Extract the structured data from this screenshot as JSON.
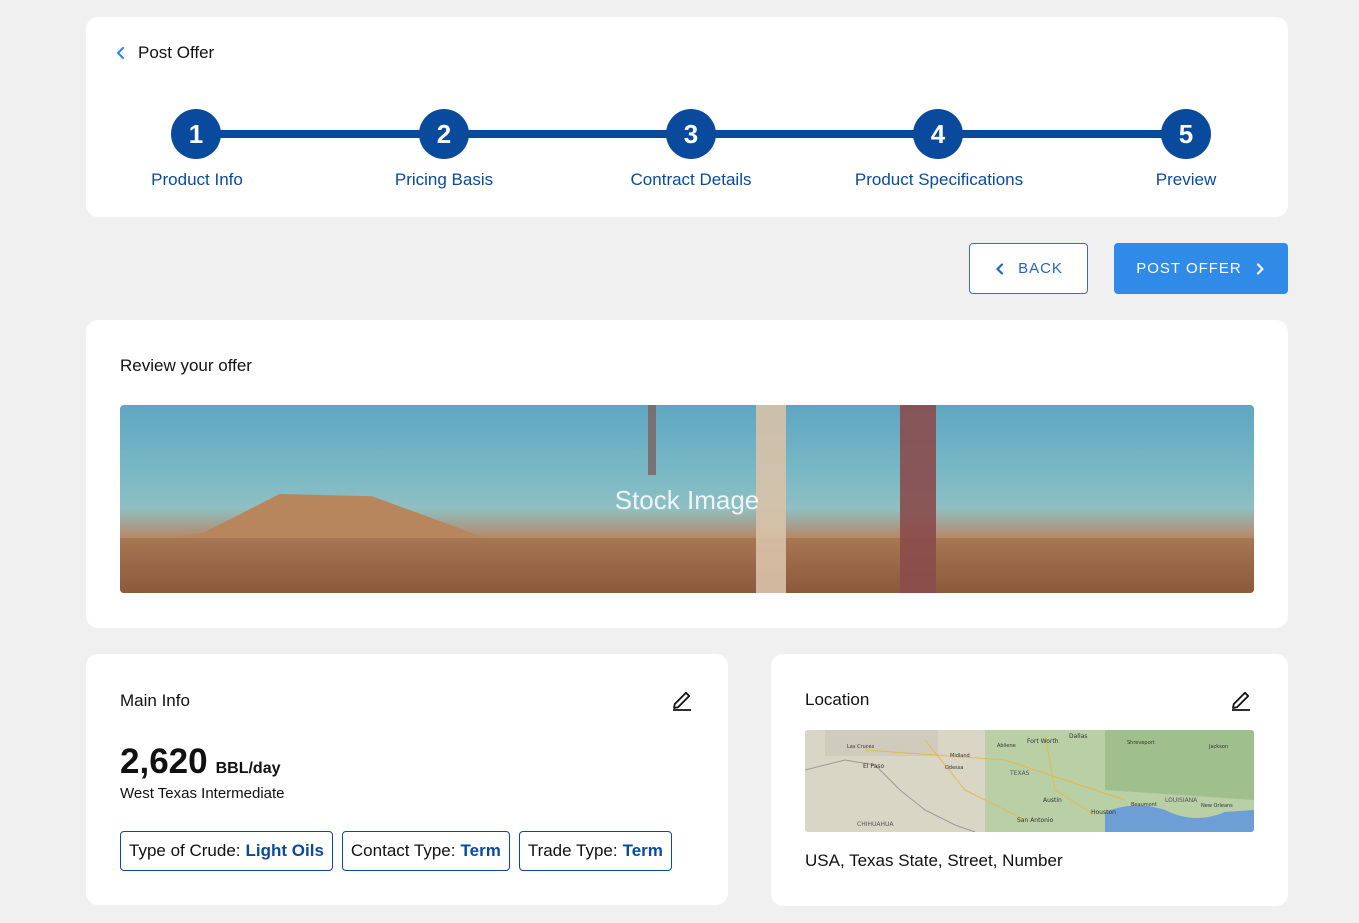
{
  "header": {
    "back_label": "Post Offer"
  },
  "stepper": {
    "steps": [
      {
        "number": "1",
        "label": "Product Info"
      },
      {
        "number": "2",
        "label": "Pricing Basis"
      },
      {
        "number": "3",
        "label": "Contract Details"
      },
      {
        "number": "4",
        "label": "Product Specifications"
      },
      {
        "number": "5",
        "label": "Preview"
      }
    ]
  },
  "actions": {
    "back_label": "BACK",
    "post_label": "POST OFFER"
  },
  "review": {
    "title": "Review your offer",
    "image_caption": "Stock Image"
  },
  "main_info": {
    "title": "Main Info",
    "amount": "2,620",
    "unit": "BBL/day",
    "product": "West Texas Intermediate",
    "chips": [
      {
        "label": "Type of Crude:",
        "value": "Light Oils"
      },
      {
        "label": "Contact Type:",
        "value": "Term"
      },
      {
        "label": "Trade Type:",
        "value": "Term"
      }
    ]
  },
  "location": {
    "title": "Location",
    "address": "USA, Texas State, Street, Number",
    "map_labels": [
      "Dallas",
      "Fort Worth",
      "El Paso",
      "TEXAS",
      "Austin",
      "Houston",
      "San Antonio",
      "CHIHUAHUA",
      "LOUISIANA",
      "Shreveport",
      "Jackson",
      "Midland",
      "Odessa",
      "Abilene",
      "Las Cruces",
      "Beaumont",
      "New Orleans"
    ]
  },
  "colors": {
    "primary": "#0a4a9c",
    "accent": "#2f8ae8"
  },
  "icons": {
    "back": "chevron-left-icon",
    "post": "chevron-right-icon",
    "edit": "pencil-icon"
  }
}
